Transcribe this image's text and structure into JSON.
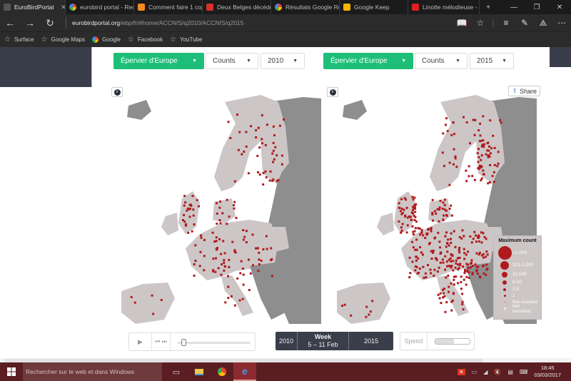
{
  "browser": {
    "tabs": [
      {
        "label": "EuroBirdPortal",
        "active": true,
        "favicon_color": "#555555"
      },
      {
        "label": "eurobird portal - Recl",
        "favicon": "google-icon"
      },
      {
        "label": "Comment faire 1 cop",
        "favicon_color": "#f28c1e"
      },
      {
        "label": "Deux Belges décéder",
        "favicon_color": "#d9302c"
      },
      {
        "label": "Résultats Google Rec",
        "favicon": "google-icon"
      },
      {
        "label": "Google Keep",
        "favicon_color": "#f6b400"
      },
      {
        "label": "Linotte mélodieuse -",
        "favicon_color": "#e02020"
      }
    ],
    "new_tab_label": "+",
    "window_controls": {
      "minimize": "—",
      "restore": "❐",
      "close": "✕"
    },
    "tab_close": "✕",
    "address": {
      "domain": "eurobirdportal.org",
      "path": "/ebp/fr/#home/ACCNIS/q2010/ACCNIS/q2015"
    },
    "favorites": [
      {
        "label": "Surface",
        "icon": "star-icon"
      },
      {
        "label": "Google Maps",
        "icon": "star-icon"
      },
      {
        "label": "Google",
        "icon": "google-icon"
      },
      {
        "label": "Facebook",
        "icon": "star-icon"
      },
      {
        "label": "YouTube",
        "icon": "star-icon"
      }
    ]
  },
  "left_panel": {
    "species": "Épervier d'Europe",
    "measure": "Counts",
    "year": "2010"
  },
  "right_panel": {
    "species": "Épervier d'Europe",
    "measure": "Counts",
    "year": "2015",
    "share_label": "Share"
  },
  "info_icon": "i",
  "legend": {
    "title": "Maximum count",
    "items": [
      {
        "label": ">1,000"
      },
      {
        "label": "101-1,000"
      },
      {
        "label": "11-100"
      },
      {
        "label": "6-10"
      },
      {
        "label": "2-5"
      },
      {
        "label": "1"
      },
      {
        "label": "Not counted"
      },
      {
        "label": "Not recorded"
      }
    ]
  },
  "player": {
    "play_icon": "▶",
    "step_icons": "⏮ ⏭",
    "progress": 0.05
  },
  "week_box": {
    "year_left": "2010",
    "week_label": "Week",
    "week_range": "5 – 11 Feb",
    "year_right": "2015"
  },
  "speed": {
    "label": "Speed",
    "value": 0.55
  },
  "taskbar": {
    "search_placeholder": "Rechercher sur le web et dans Windows",
    "time": "18:45",
    "date": "03/03/2017"
  },
  "colors": {
    "accent_green": "#1dbf78",
    "dot_red": "#b0191e",
    "land_covered": "#cdc6c6",
    "land_uncovered": "#8e8e8e",
    "header_dark": "#3a3e4a"
  }
}
